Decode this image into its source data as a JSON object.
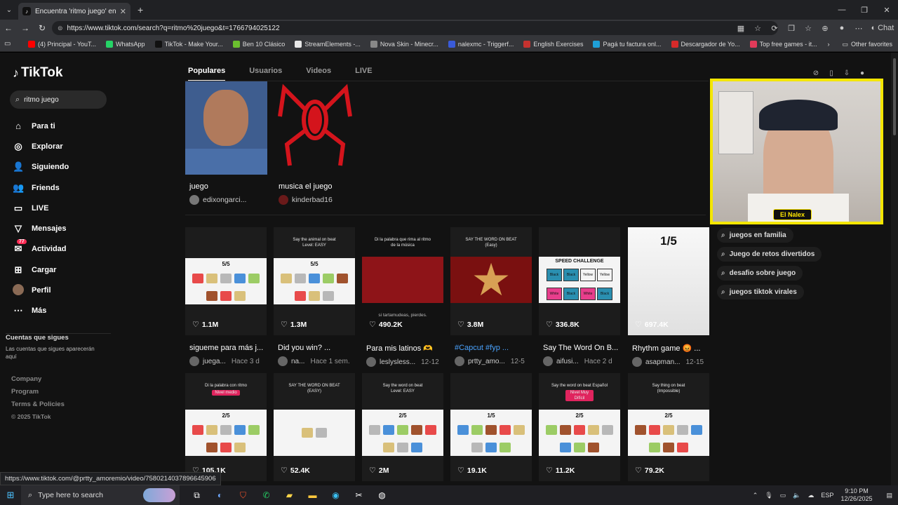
{
  "browser": {
    "tab_title": "Encuentra 'ritmo juego' en TikTok",
    "url": "https://www.tiktok.com/search?q=ritmo%20juego&t=1766794025122",
    "bookmarks": [
      {
        "label": "(4) Principal - YouT...",
        "color": "#ff0000"
      },
      {
        "label": "WhatsApp",
        "color": "#25d366"
      },
      {
        "label": "TikTok - Make Your...",
        "color": "#111111"
      },
      {
        "label": "Ben 10 Clásico",
        "color": "#6bbf2f"
      },
      {
        "label": "StreamElements -...",
        "color": "#e8e8e8"
      },
      {
        "label": "Nova Skin - Minecr...",
        "color": "#888888"
      },
      {
        "label": "nalexmc - Triggerf...",
        "color": "#3a5bd9"
      },
      {
        "label": "English Exercises",
        "color": "#c4322f"
      },
      {
        "label": "Pagá tu factura onl...",
        "color": "#1fa0d8"
      },
      {
        "label": "Descargador de Yo...",
        "color": "#d62a2a"
      },
      {
        "label": "Top free games - it...",
        "color": "#e23b5a"
      }
    ],
    "other_favorites": "Other favorites",
    "copilot": "Chat",
    "status_url": "https://www.tiktok.com/@prtty_amoremio/video/7580214037896645906"
  },
  "sidebar": {
    "logo": "TikTok",
    "search_value": "ritmo juego",
    "nav": [
      {
        "label": "Para ti",
        "icon": "home-icon",
        "glyph": "⌂"
      },
      {
        "label": "Explorar",
        "icon": "compass-icon",
        "glyph": "◎"
      },
      {
        "label": "Siguiendo",
        "icon": "following-icon",
        "glyph": "👤"
      },
      {
        "label": "Friends",
        "icon": "friends-icon",
        "glyph": "👥"
      },
      {
        "label": "LIVE",
        "icon": "live-icon",
        "glyph": "▭"
      },
      {
        "label": "Mensajes",
        "icon": "messages-icon",
        "glyph": "▽"
      },
      {
        "label": "Actividad",
        "icon": "activity-icon",
        "glyph": "✉"
      },
      {
        "label": "Cargar",
        "icon": "upload-icon",
        "glyph": "⊞"
      },
      {
        "label": "Perfil",
        "icon": "profile-icon",
        "glyph": ""
      },
      {
        "label": "Más",
        "icon": "more-icon",
        "glyph": "⋯"
      }
    ],
    "activity_badge": "77",
    "following_title": "Cuentas que sigues",
    "following_desc": "Las cuentas que sigues aparecerán aquí",
    "footer": [
      "Company",
      "Program",
      "Terms & Policies"
    ],
    "copyright": "© 2025 TikTok"
  },
  "search_tabs": [
    "Populares",
    "Usuarios",
    "Videos",
    "LIVE"
  ],
  "accounts": [
    {
      "title": "juego",
      "user": "edixongarci..."
    },
    {
      "title": "musica el juego",
      "user": "kinderbad16"
    }
  ],
  "videos_row1": [
    {
      "likes": "1.1M",
      "title": "sigueme para más j...",
      "user": "juega...",
      "date": "Hace 3 d",
      "caption": "",
      "score": "5/5"
    },
    {
      "likes": "1.3M",
      "title": "Did you win? ...",
      "user": "na...",
      "date": "Hace 1 sem.",
      "caption": "Say the animal on beat\nLevel: EASY",
      "score": "5/5"
    },
    {
      "likes": "490.2K",
      "title": "Para mis latinos 🫶",
      "user": "leslysless...",
      "date": "12-12",
      "caption": "Di la palabra que rima al ritmo\nde la música",
      "overlay": "si tartamudeas, pierdes."
    },
    {
      "likes": "3.8M",
      "title": "#Capcut #fyp ...",
      "user": "prtty_amo...",
      "date": "12-5",
      "caption": "SAY THE WORD ON BEAT\n(Easy)"
    },
    {
      "likes": "336.8K",
      "title": "Say The Word On B...",
      "user": "aifusi...",
      "date": "Hace 2 d",
      "caption": "",
      "banner": "SPEED CHALLENGE",
      "words": [
        "Black",
        "Black",
        "Yellow",
        "Yellow",
        "White",
        "Black",
        "White",
        "Black"
      ]
    },
    {
      "likes": "697.4K",
      "title": "Rhythm game 😡 ...",
      "user": "asapman...",
      "date": "12-15",
      "caption": "",
      "score": "1/5"
    }
  ],
  "videos_row2": [
    {
      "likes": "105.1K",
      "caption": "Di la palabra con ritmo",
      "tag": "Nivel medio",
      "score": "2/5"
    },
    {
      "likes": "52.4K",
      "caption": "SAY THE WORD ON BEAT\n(EASY)",
      "score": ""
    },
    {
      "likes": "2M",
      "caption": "Say the word on beat\nLevel: EASY",
      "score": "2/5"
    },
    {
      "likes": "19.1K",
      "caption": "",
      "score": "1/5"
    },
    {
      "likes": "11.2K",
      "caption": "Say the word on beat Español",
      "tag": "Nivel Muy Difícil",
      "score": "2/5"
    },
    {
      "likes": "79.2K",
      "caption": "Say thing on beat\n(Impossible)",
      "score": "2/5"
    }
  ],
  "webcam_label": "El Nalex",
  "related_searches": [
    "juegos en familia",
    "Juego de retos divertidos",
    "desafio sobre juego",
    "juegos tiktok virales"
  ],
  "taskbar": {
    "search_placeholder": "Type here to search",
    "lang": "ESP",
    "time": "9:10 PM",
    "date": "12/26/2025"
  }
}
